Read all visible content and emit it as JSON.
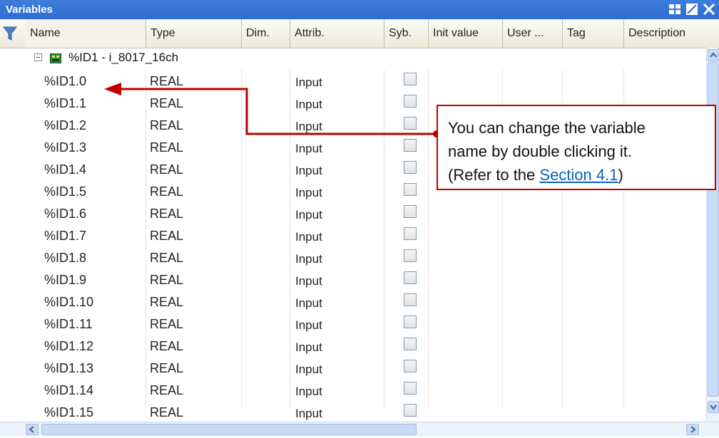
{
  "window": {
    "title": "Variables"
  },
  "columns": [
    "Name",
    "Type",
    "Dim.",
    "Attrib.",
    "Syb.",
    "Init value",
    "User ...",
    "Tag",
    "Description"
  ],
  "group": {
    "label": "%ID1 - i_8017_16ch"
  },
  "rows": [
    {
      "name": "%ID1.0",
      "type": "REAL",
      "attrib": "Input"
    },
    {
      "name": "%ID1.1",
      "type": "REAL",
      "attrib": "Input"
    },
    {
      "name": "%ID1.2",
      "type": "REAL",
      "attrib": "Input"
    },
    {
      "name": "%ID1.3",
      "type": "REAL",
      "attrib": "Input"
    },
    {
      "name": "%ID1.4",
      "type": "REAL",
      "attrib": "Input"
    },
    {
      "name": "%ID1.5",
      "type": "REAL",
      "attrib": "Input"
    },
    {
      "name": "%ID1.6",
      "type": "REAL",
      "attrib": "Input"
    },
    {
      "name": "%ID1.7",
      "type": "REAL",
      "attrib": "Input"
    },
    {
      "name": "%ID1.8",
      "type": "REAL",
      "attrib": "Input"
    },
    {
      "name": "%ID1.9",
      "type": "REAL",
      "attrib": "Input"
    },
    {
      "name": "%ID1.10",
      "type": "REAL",
      "attrib": "Input"
    },
    {
      "name": "%ID1.11",
      "type": "REAL",
      "attrib": "Input"
    },
    {
      "name": "%ID1.12",
      "type": "REAL",
      "attrib": "Input"
    },
    {
      "name": "%ID1.13",
      "type": "REAL",
      "attrib": "Input"
    },
    {
      "name": "%ID1.14",
      "type": "REAL",
      "attrib": "Input"
    },
    {
      "name": "%ID1.15",
      "type": "REAL",
      "attrib": "Input"
    }
  ],
  "callout": {
    "line1": "You can change the variable",
    "line2": "name by double clicking it.",
    "line3_prefix": "(Refer to the ",
    "link": "Section 4.1",
    "line3_suffix": ")"
  },
  "colors": {
    "titlebar": "#2f6ccf",
    "callout_border": "#c00000",
    "link": "#0563c1"
  }
}
